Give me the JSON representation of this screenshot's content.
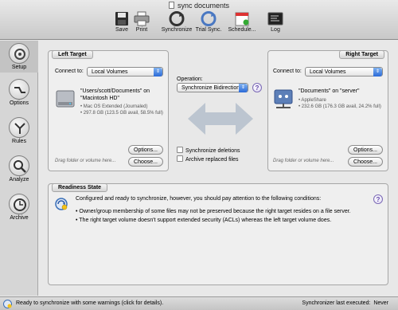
{
  "window": {
    "title": "sync documents"
  },
  "toolbar": {
    "items": [
      {
        "label": "Save"
      },
      {
        "label": "Print"
      },
      {
        "label": "Synchronize"
      },
      {
        "label": "Trial Sync."
      },
      {
        "label": "Schedule..."
      },
      {
        "label": "Log"
      }
    ]
  },
  "sidebar": {
    "items": [
      {
        "label": "Setup"
      },
      {
        "label": "Options"
      },
      {
        "label": "Rules"
      },
      {
        "label": "Analyze"
      },
      {
        "label": "Archive"
      }
    ]
  },
  "left_target": {
    "title": "Left Target",
    "connect_label": "Connect to:",
    "connect_value": "Local Volumes",
    "volume_name": "\"Users/scott/Documents\" on \"Macintosh HD\"",
    "volume_format": "• Mac OS Extended (Journaled)",
    "volume_size": "• 297.8 GB (123.5 GB avail, 58.5% full)",
    "options_label": "Options...",
    "choose_label": "Choose...",
    "drag_hint": "Drag folder or volume here..."
  },
  "operation": {
    "label": "Operation:",
    "value": "Synchronize Bidirectional",
    "sync_deletions_label": "Synchronize deletions",
    "archive_replaced_label": "Archive replaced files",
    "help": "?"
  },
  "right_target": {
    "title": "Right Target",
    "connect_label": "Connect to:",
    "connect_value": "Local Volumes",
    "volume_name": "\"Documents\" on \"server\"",
    "volume_format": "• AppleShare",
    "volume_size": "• 232.6 GB (176.3 GB avail, 24.2% full)",
    "options_label": "Options...",
    "choose_label": "Choose...",
    "drag_hint": "Drag folder or volume here..."
  },
  "readiness": {
    "title": "Readiness State",
    "message": "Configured and ready to synchronize, however, you should pay attention to the following conditions:",
    "bullets": [
      "• Owner/group membership of some files may not be preserved because the right target resides on a file server.",
      "• The right target volume doesn't support extended security (ACLs) whereas the left target volume does."
    ],
    "help": "?"
  },
  "status": {
    "left": "Ready to synchronize with some warnings (click for details).",
    "right_label": "Synchronizer last executed:",
    "right_value": "Never"
  }
}
